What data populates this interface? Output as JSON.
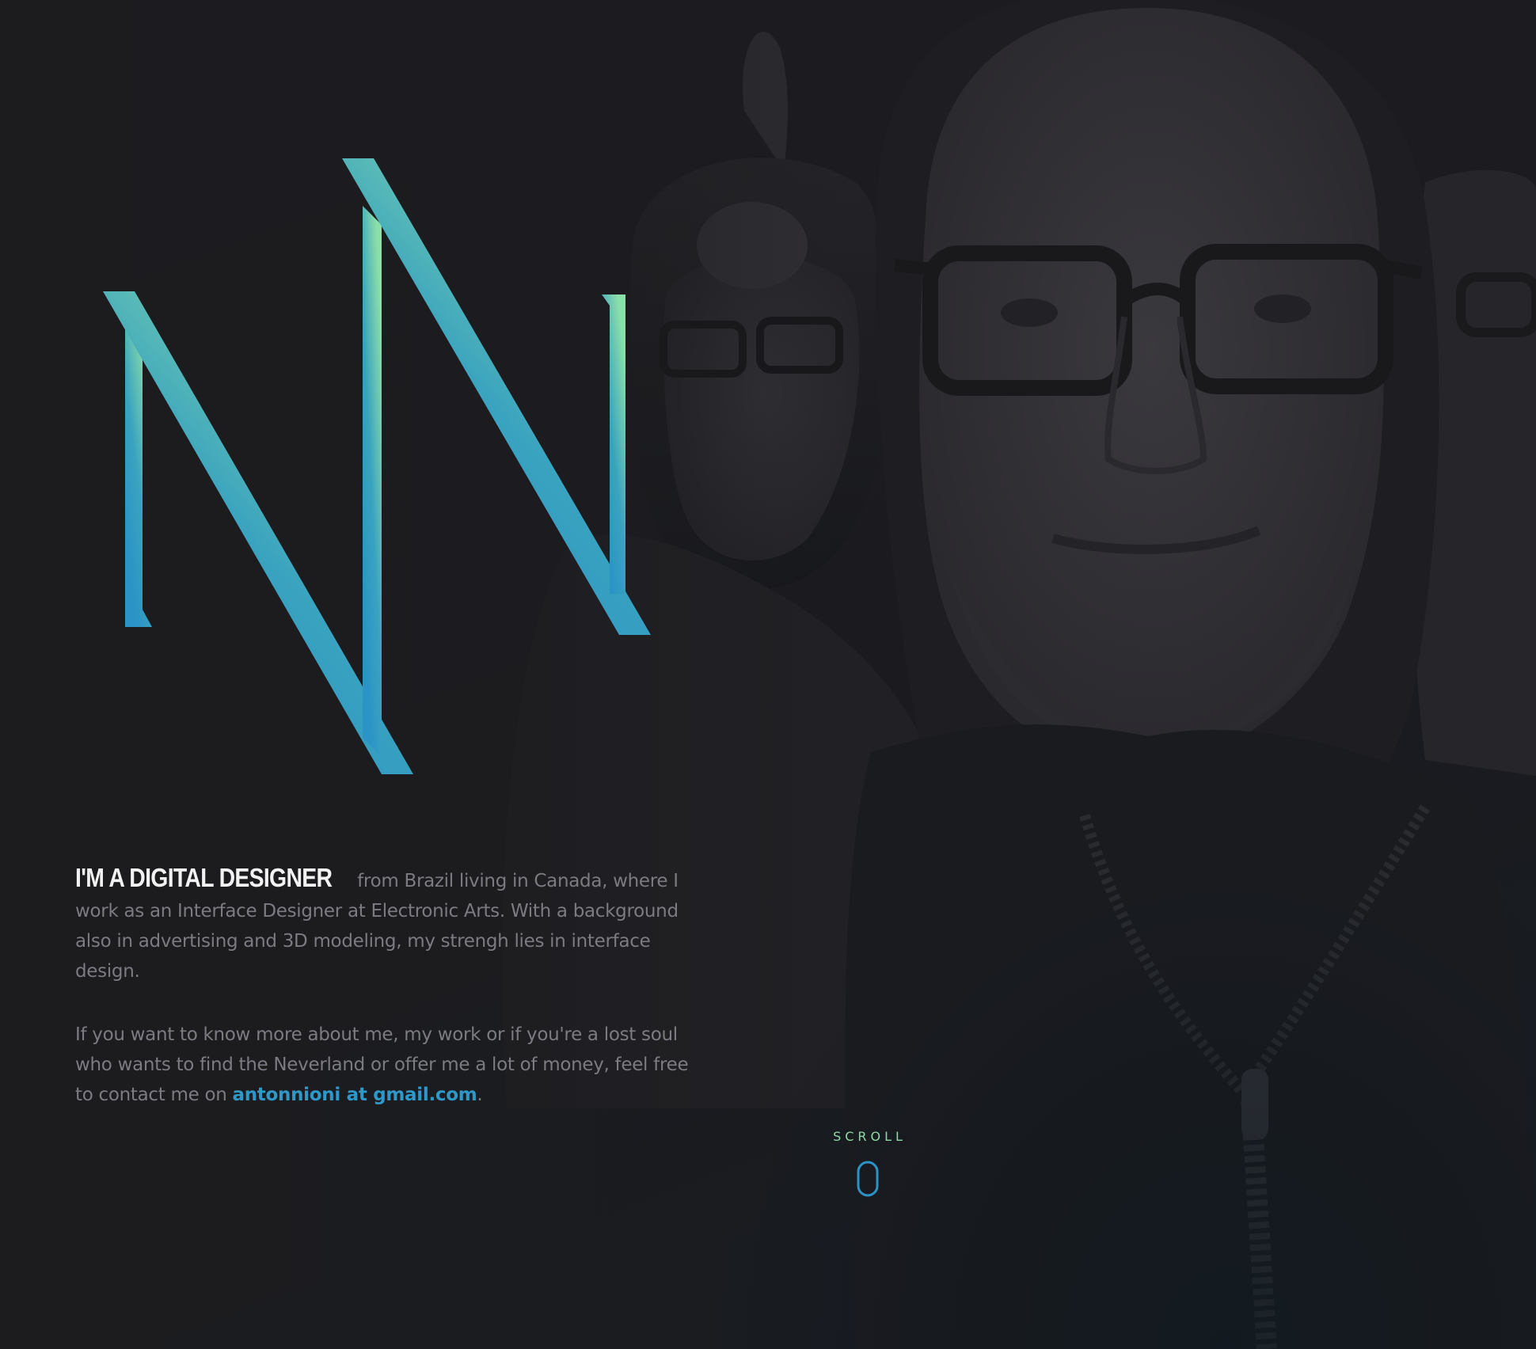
{
  "logo": {
    "alt": "NN",
    "gradient_start": "#2b93c6",
    "gradient_end": "#8cdfa9"
  },
  "intro": {
    "headline": "I'M A DIGITAL DESIGNER",
    "paragraph1": "from Brazil living in Canada, where I work as an Interface Designer at Electronic Arts. With a background also in advertising and 3D modeling, my strengh lies in interface design.",
    "paragraph2_prefix": "If you want to know more about me, my work or if you're a lost soul who wants to find the Neverland or offer me a lot of money, feel free to contact me on",
    "email": "antonnioni at gmail.com",
    "paragraph2_suffix": "."
  },
  "scroll": {
    "label": "SCROLL",
    "color_top": "#2b93c6",
    "color_bottom": "#8cdfa9"
  },
  "colors": {
    "background": "#1c1c1f",
    "text": "#7b7b82",
    "accent": "#2e98c8"
  }
}
